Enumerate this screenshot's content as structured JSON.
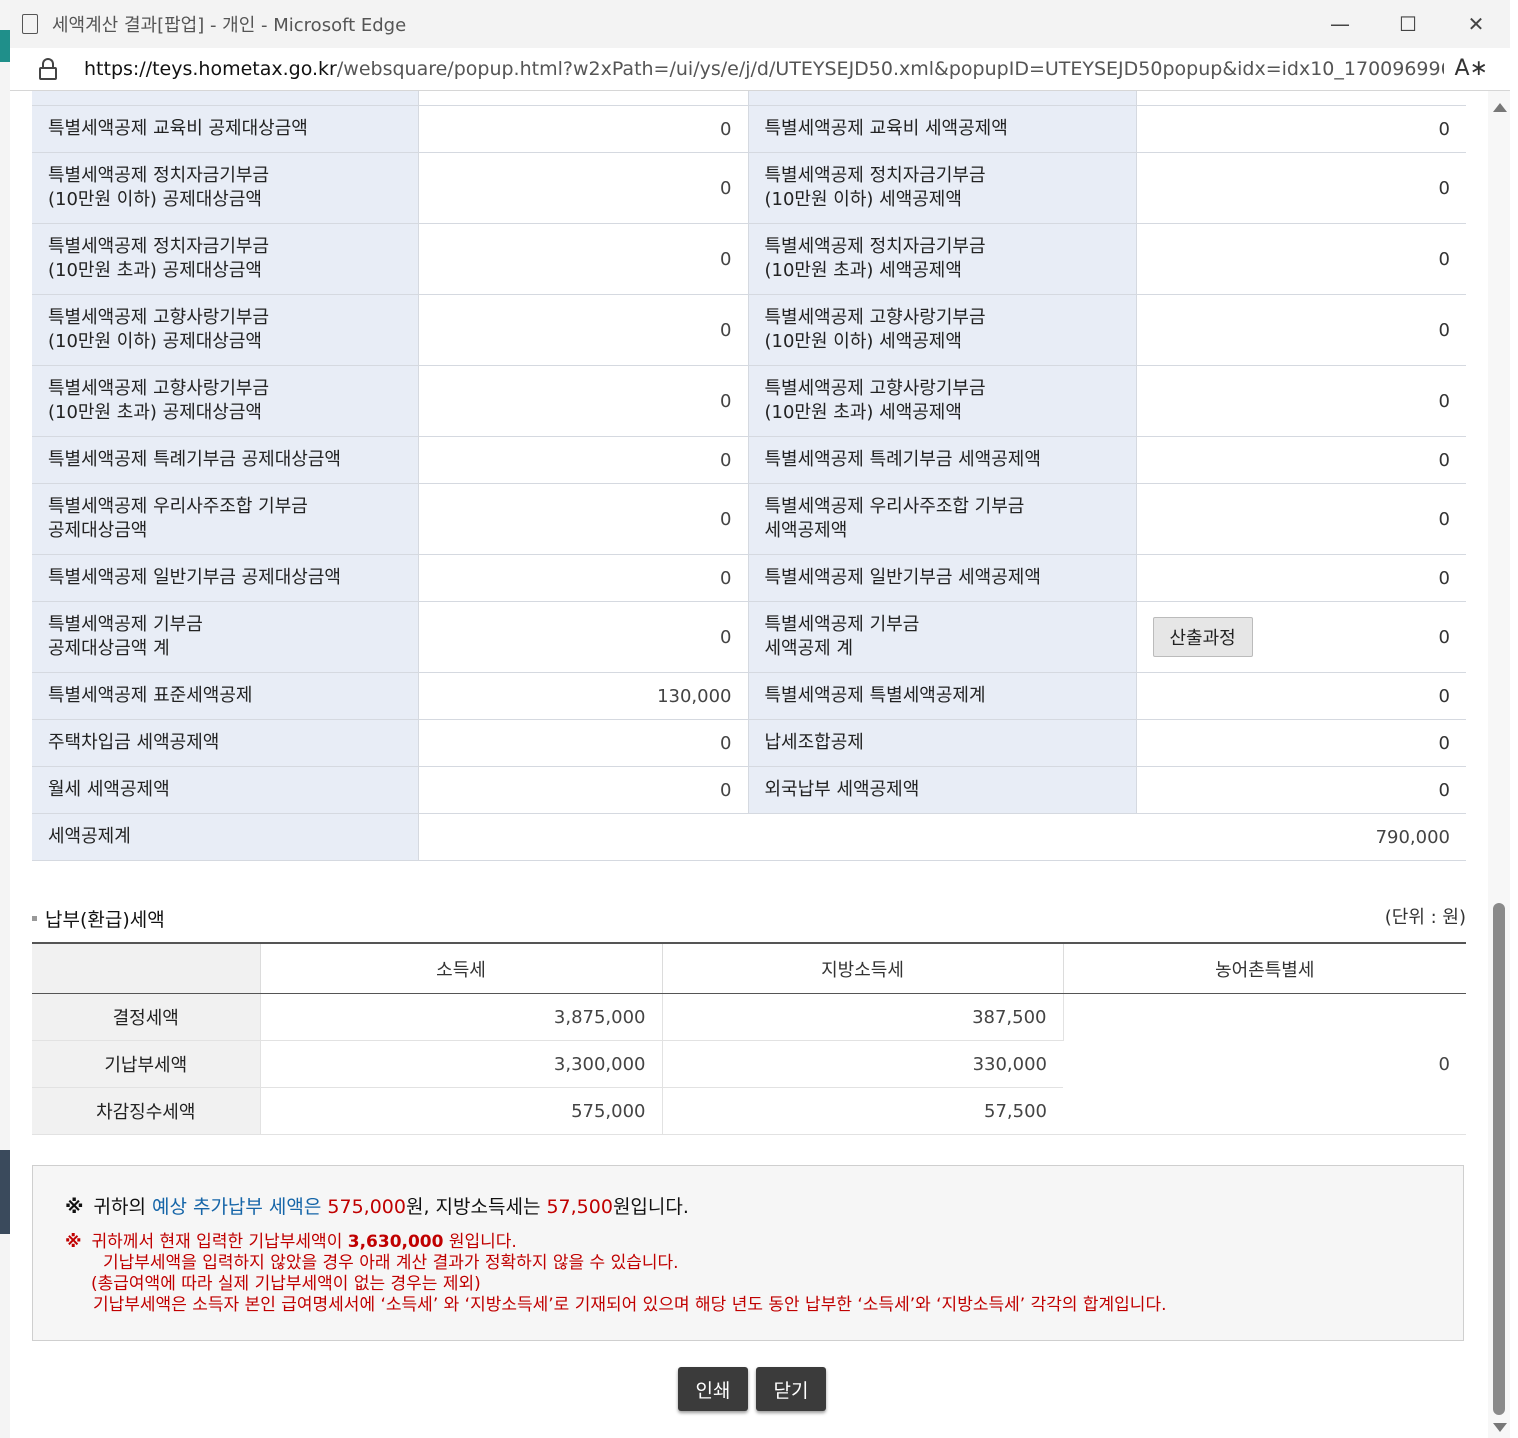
{
  "window": {
    "title": "세액계산 결과[팝업] - 개인 - Microsoft Edge",
    "url_host": "https://teys.hometax.go.kr",
    "url_path": "/websquare/popup.html?w2xPath=/ui/ys/e/j/d/UTEYSEJD50.xml&popupID=UTEYSEJD50popup&idx=idx10_170096996...",
    "controls": [
      "minimize-icon",
      "maximize-icon",
      "close-icon"
    ]
  },
  "deductions": {
    "rows": [
      {
        "l1": "특별세액공제 교육비 공제대상금액",
        "v1": "0",
        "l2": "특별세액공제 교육비 세액공제액",
        "v2": "0"
      },
      {
        "l1": "특별세액공제 정치자금기부금\n(10만원 이하) 공제대상금액",
        "v1": "0",
        "l2": "특별세액공제 정치자금기부금\n(10만원 이하) 세액공제액",
        "v2": "0"
      },
      {
        "l1": "특별세액공제 정치자금기부금\n(10만원 초과) 공제대상금액",
        "v1": "0",
        "l2": "특별세액공제 정치자금기부금\n(10만원 초과) 세액공제액",
        "v2": "0"
      },
      {
        "l1": "특별세액공제 고향사랑기부금\n(10만원 이하) 공제대상금액",
        "v1": "0",
        "l2": "특별세액공제 고향사랑기부금\n(10만원 이하) 세액공제액",
        "v2": "0"
      },
      {
        "l1": "특별세액공제 고향사랑기부금\n(10만원 초과) 공제대상금액",
        "v1": "0",
        "l2": "특별세액공제 고향사랑기부금\n(10만원 초과) 세액공제액",
        "v2": "0"
      },
      {
        "l1": "특별세액공제 특례기부금 공제대상금액",
        "v1": "0",
        "l2": "특별세액공제 특례기부금 세액공제액",
        "v2": "0"
      },
      {
        "l1": "특별세액공제 우리사주조합 기부금\n공제대상금액",
        "v1": "0",
        "l2": "특별세액공제 우리사주조합 기부금\n세액공제액",
        "v2": "0"
      },
      {
        "l1": "특별세액공제 일반기부금 공제대상금액",
        "v1": "0",
        "l2": "특별세액공제 일반기부금 세액공제액",
        "v2": "0"
      },
      {
        "l1": "특별세액공제 기부금\n공제대상금액 계",
        "v1": "0",
        "l2": "특별세액공제 기부금\n세액공제 계",
        "v2": "0",
        "button": "산출과정"
      },
      {
        "l1": "특별세액공제 표준세액공제",
        "v1": "130,000",
        "l2": "특별세액공제 특별세액공제계",
        "v2": "0"
      },
      {
        "l1": "주택차입금 세액공제액",
        "v1": "0",
        "l2": "납세조합공제",
        "v2": "0"
      },
      {
        "l1": "월세 세액공제액",
        "v1": "0",
        "l2": "외국납부 세액공제액",
        "v2": "0"
      }
    ],
    "total_label": "세액공제계",
    "total_value": "790,000"
  },
  "payment": {
    "title": "납부(환급)세액",
    "unit": "(단위 : 원)",
    "headers": [
      "소득세",
      "지방소득세",
      "농어촌특별세"
    ],
    "rows": [
      {
        "label": "결정세액",
        "income": "3,875,000",
        "local": "387,500"
      },
      {
        "label": "기납부세액",
        "income": "3,300,000",
        "local": "330,000"
      },
      {
        "label": "차감징수세액",
        "income": "575,000",
        "local": "57,500"
      }
    ],
    "rural": "0"
  },
  "notice": {
    "mark": "※",
    "l1_a": "귀하의 ",
    "l1_b": "예상 추가납부 세액은",
    "l1_c": " 575,000",
    "l1_d": "원,   지방소득세는 ",
    "l1_e": "57,500",
    "l1_f": "원입니다.",
    "w_a": "귀하께서 현재 입력한 기납부세액이 ",
    "w_amt": "3,630,000",
    "w_b": " 원입니다.",
    "w2": "기납부세액을 입력하지 않았을 경우 아래 계산 결과가 정확하지 않을 수 있습니다.",
    "w3": "(총급여액에 따라 실제 기납부세액이 없는 경우는 제외)",
    "w4": "기납부세액은 소득자 본인 급여명세서에 ‘소득세’ 와 ‘지방소득세’로 기재되어 있으며 해당 년도 동안 납부한 ‘소득세’와 ‘지방소득세’ 각각의 합계입니다."
  },
  "buttons": {
    "print": "인쇄",
    "close": "닫기"
  }
}
